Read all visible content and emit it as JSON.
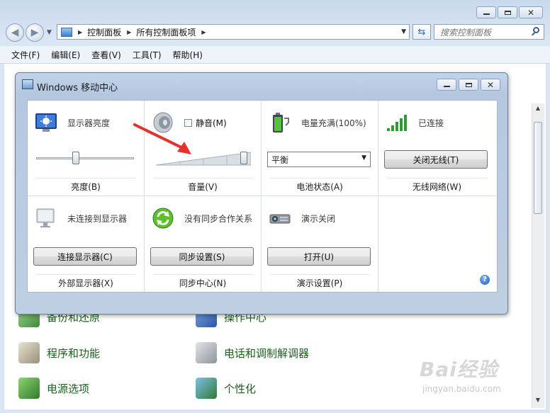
{
  "window": {
    "address": [
      "控制面板",
      "所有控制面板项"
    ],
    "search_placeholder": "搜索控制面板"
  },
  "menubar": [
    "文件(F)",
    "编辑(E)",
    "查看(V)",
    "工具(T)",
    "帮助(H)"
  ],
  "control_panel_items": [
    {
      "label": "备份和还原",
      "icon": "backup-restore-icon"
    },
    {
      "label": "操作中心",
      "icon": "action-center-flag-icon"
    },
    {
      "label": "程序和功能",
      "icon": "programs-features-icon"
    },
    {
      "label": "电话和调制解调器",
      "icon": "phone-modem-icon"
    },
    {
      "label": "电源选项",
      "icon": "power-options-icon"
    },
    {
      "label": "个性化",
      "icon": "personalization-icon"
    }
  ],
  "mobility_center": {
    "title": "Windows 移动中心",
    "brightness": {
      "header": "显示器亮度",
      "footer": "亮度(B)",
      "level": 0.4
    },
    "volume": {
      "mute_label": "静音(M)",
      "footer": "音量(V)",
      "level": 1.0,
      "muted": false
    },
    "battery": {
      "status": "电量充满(100%)",
      "plan": "平衡",
      "footer": "电池状态(A)"
    },
    "wireless": {
      "status": "已连接",
      "button": "关闭无线(T)",
      "footer": "无线网络(W)"
    },
    "display": {
      "status": "未连接到显示器",
      "button": "连接显示器(C)",
      "footer": "外部显示器(X)"
    },
    "sync": {
      "status": "没有同步合作关系",
      "button": "同步设置(S)",
      "footer": "同步中心(N)"
    },
    "presentation": {
      "status": "演示关闭",
      "button": "打开(U)",
      "footer": "演示设置(P)"
    },
    "help_glyph": "?"
  },
  "annotation": {
    "arrow_color": "#e8312a"
  },
  "watermark": {
    "main": "Bai经验",
    "sub": "jingyan.baidu.com"
  }
}
